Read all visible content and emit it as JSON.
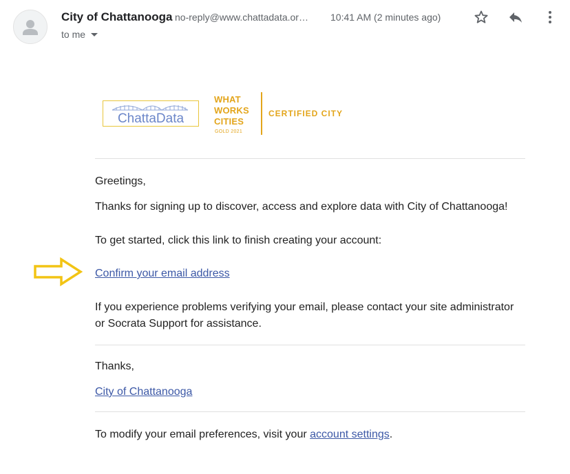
{
  "header": {
    "sender_name": "City of Chattanooga",
    "sender_email": "no-reply@www.chattadata.or…",
    "time": "10:41 AM (2 minutes ago)",
    "recipient": "to me"
  },
  "logos": {
    "chattadata": "ChattaData",
    "wwc_line1": "WHAT",
    "wwc_line2": "WORKS",
    "wwc_line3": "CITIES",
    "wwc_small": "GOLD 2021",
    "certified": "CERTIFIED CITY"
  },
  "body": {
    "greeting": "Greetings,",
    "thanks_signup": "Thanks for signing up to discover, access and explore data with City of Chattanooga!",
    "get_started": "To get started, click this link to finish creating your account:",
    "confirm_link": "Confirm your email address",
    "problems_line1": "If you experience problems verifying your email, please contact your site administrator",
    "problems_line2": "or Socrata Support for assistance.",
    "thanks": "Thanks,",
    "signature_link": "City of Chattanooga",
    "prefs_prefix": "To modify your email preferences, visit your ",
    "prefs_link": "account settings",
    "prefs_suffix": "."
  },
  "icons": {
    "avatar": "person-icon",
    "star": "star-icon",
    "reply": "reply-icon",
    "more": "more-vert-icon",
    "arrow": "arrow-right-icon"
  },
  "colors": {
    "link": "#3c58a6",
    "brand_gold": "#e3a51b",
    "chattadata_blue": "#6b86c9",
    "arrow_yellow": "#f2c414"
  }
}
